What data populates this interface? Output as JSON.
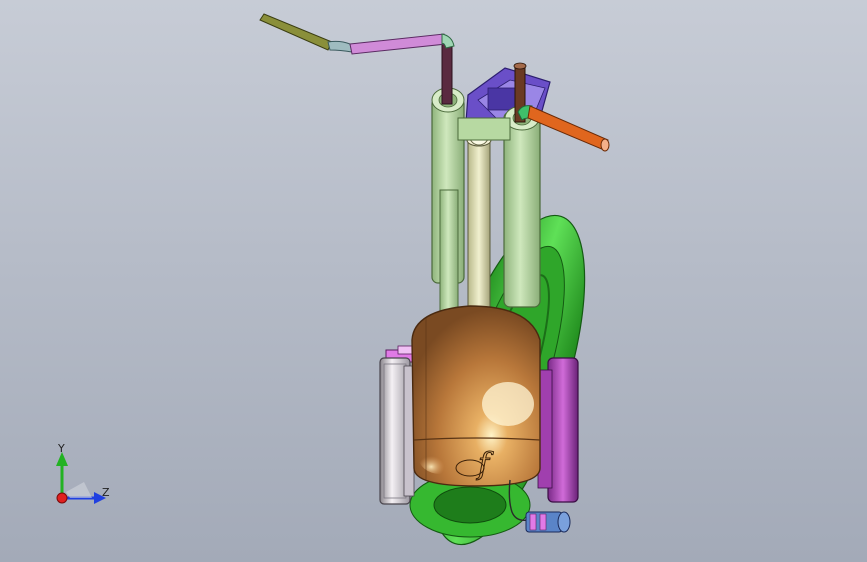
{
  "view": {
    "background_top": "#c7ccd6",
    "background_bottom": "#a3aab8"
  },
  "model": {
    "parts": [
      {
        "name": "handlebar-left",
        "color": "#8a8f3a"
      },
      {
        "name": "handlebar-center",
        "color": "#d08bd8"
      },
      {
        "name": "handlebar-right",
        "color": "#e0661e"
      },
      {
        "name": "fork-tubes",
        "color": "#b7d9a2"
      },
      {
        "name": "front-wheel",
        "color": "#3fc33a"
      },
      {
        "name": "body-shell",
        "color": "#b87a3c"
      },
      {
        "name": "side-drum-left",
        "color": "#e6dfe6"
      },
      {
        "name": "side-drum-right",
        "color": "#b64fc0"
      },
      {
        "name": "top-clamp",
        "color": "#6a4fc8"
      },
      {
        "name": "battery-plug",
        "color": "#5a84c8"
      }
    ],
    "logo": "f"
  },
  "triad": {
    "y_label": "Y",
    "z_label": "Z",
    "x_color": "#e02020",
    "y_color": "#22b222",
    "z_color": "#2040e0"
  }
}
